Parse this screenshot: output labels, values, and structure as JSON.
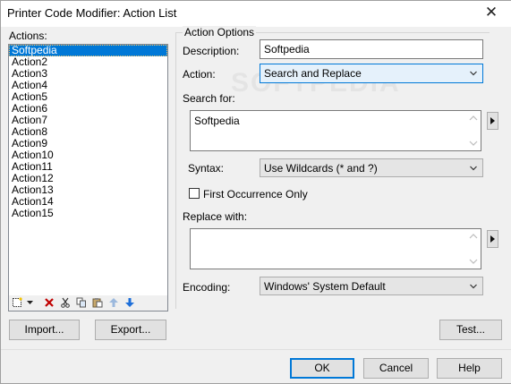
{
  "window": {
    "title": "Printer Code Modifier: Action List",
    "close_glyph": "✕"
  },
  "actions": {
    "label": "Actions:",
    "items": [
      "Softpedia",
      "Action2",
      "Action3",
      "Action4",
      "Action5",
      "Action6",
      "Action7",
      "Action8",
      "Action9",
      "Action10",
      "Action11",
      "Action12",
      "Action13",
      "Action14",
      "Action15"
    ],
    "selected_index": 0,
    "toolbar_icons": [
      "new-icon",
      "dropdown-arrow-icon",
      "delete-icon",
      "cut-icon",
      "copy-icon",
      "paste-icon",
      "move-up-icon",
      "move-down-icon"
    ]
  },
  "options": {
    "group_label": "Action Options",
    "description_label": "Description:",
    "description_value": "Softpedia",
    "action_label": "Action:",
    "action_value": "Search and Replace",
    "search_label": "Search for:",
    "search_value": "Softpedia",
    "syntax_label": "Syntax:",
    "syntax_value": "Use Wildcards (* and ?)",
    "first_occurrence_label": "First Occurrence Only",
    "first_occurrence_checked": false,
    "replace_label": "Replace with:",
    "replace_value": "",
    "encoding_label": "Encoding:",
    "encoding_value": "Windows' System Default"
  },
  "buttons": {
    "import": "Import...",
    "export": "Export...",
    "test": "Test...",
    "ok": "OK",
    "cancel": "Cancel",
    "help": "Help"
  },
  "watermark": "SOFTPEDIA",
  "colors": {
    "selection": "#0078d7",
    "focus_border": "#0078d7",
    "delete_icon": "#c00000",
    "arrow_icon": "#1e6fd9"
  }
}
